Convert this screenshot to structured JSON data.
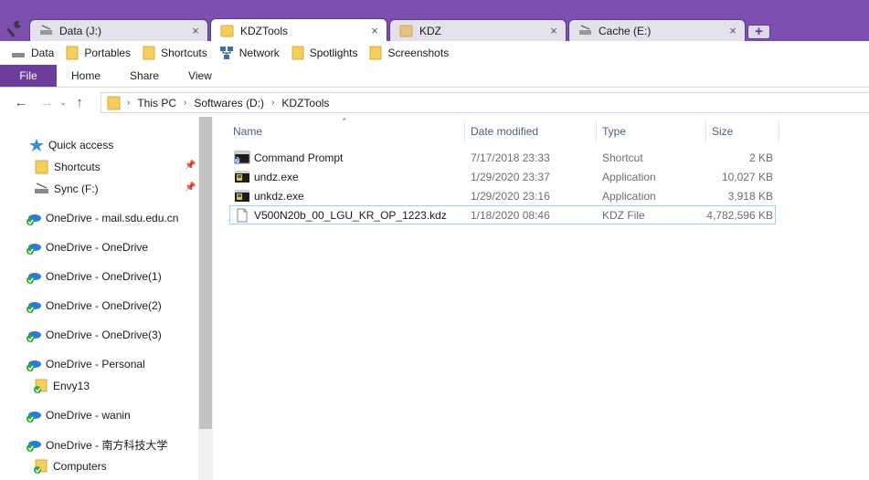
{
  "tabs": [
    {
      "label": "Data (J:)",
      "icon": "drive-icon",
      "active": false
    },
    {
      "label": "KDZTools",
      "icon": "folder-icon",
      "active": true
    },
    {
      "label": "KDZ",
      "icon": "folder-icon",
      "active": false
    },
    {
      "label": "Cache (E:)",
      "icon": "drive-icon",
      "active": false
    }
  ],
  "tab_close_glyph": "×",
  "new_tab_glyph": "+",
  "favorites": [
    {
      "label": "Data",
      "icon": "drive-icon"
    },
    {
      "label": "Portables",
      "icon": "folder-icon"
    },
    {
      "label": "Shortcuts",
      "icon": "folder-icon"
    },
    {
      "label": "Network",
      "icon": "network-icon"
    },
    {
      "label": "Spotlights",
      "icon": "folder-icon"
    },
    {
      "label": "Screenshots",
      "icon": "folder-icon"
    }
  ],
  "ribbon": {
    "file": "File",
    "home": "Home",
    "share": "Share",
    "view": "View"
  },
  "nav": {
    "back": "←",
    "forward": "→",
    "recent": "⌄",
    "up": "↑"
  },
  "breadcrumb": [
    "This PC",
    "Softwares (D:)",
    "KDZTools"
  ],
  "breadcrumb_sep": "›",
  "nav_pane": [
    {
      "label": "Quick access",
      "icon": "star-icon"
    },
    {
      "label": "Shortcuts",
      "icon": "folder-icon",
      "pinned": true
    },
    {
      "label": "Sync (F:)",
      "icon": "sync-drive-icon",
      "pinned": true
    },
    {
      "label": "OneDrive - mail.sdu.edu.cn",
      "icon": "onedrive-icon"
    },
    {
      "label": "OneDrive - OneDrive",
      "icon": "onedrive-icon"
    },
    {
      "label": "OneDrive - OneDrive(1)",
      "icon": "onedrive-icon"
    },
    {
      "label": "OneDrive - OneDrive(2)",
      "icon": "onedrive-icon"
    },
    {
      "label": "OneDrive - OneDrive(3)",
      "icon": "onedrive-icon"
    },
    {
      "label": "OneDrive - Personal",
      "icon": "onedrive-icon"
    },
    {
      "label": "Envy13",
      "icon": "folder-synced-icon"
    },
    {
      "label": "OneDrive - wanin",
      "icon": "onedrive-icon"
    },
    {
      "label": "OneDrive - 南方科技大学",
      "icon": "onedrive-icon"
    },
    {
      "label": "Computers",
      "icon": "folder-synced-icon"
    }
  ],
  "pin_glyph": "📌",
  "sort_glyph": "⌃",
  "columns": {
    "name": "Name",
    "date": "Date modified",
    "type": "Type",
    "size": "Size"
  },
  "files": [
    {
      "name": "Command Prompt",
      "icon": "cmd-icon",
      "date": "7/17/2018 23:33",
      "type": "Shortcut",
      "size": "2 KB",
      "selected": false
    },
    {
      "name": "undz.exe",
      "icon": "exe-icon",
      "date": "1/29/2020 23:37",
      "type": "Application",
      "size": "10,027 KB",
      "selected": false
    },
    {
      "name": "unkdz.exe",
      "icon": "exe-icon",
      "date": "1/29/2020 23:16",
      "type": "Application",
      "size": "3,918 KB",
      "selected": false
    },
    {
      "name": "V500N20b_00_LGU_KR_OP_1223.kdz",
      "icon": "file-icon",
      "date": "1/18/2020 08:46",
      "type": "KDZ File",
      "size": "4,782,596 KB",
      "selected": true
    }
  ],
  "colors": {
    "accent": "#7d4fb0",
    "file_tab": "#6a3e9a",
    "folder": "#f5cf5d",
    "onedrive": "#2b7cd3",
    "sync_ok": "#2fa83f",
    "selection_border": "#99d1ff"
  }
}
